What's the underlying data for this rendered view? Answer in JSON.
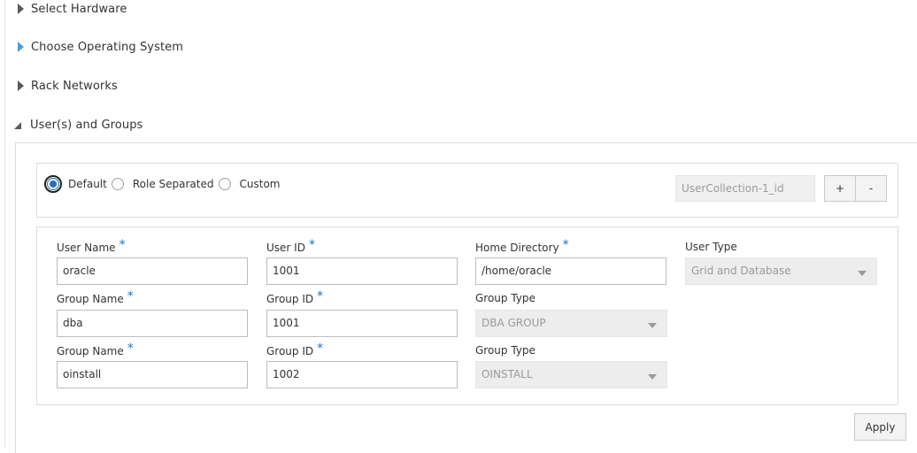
{
  "sections": [
    {
      "title": "Select Hardware",
      "state": "collapsed"
    },
    {
      "title": "Choose Operating System",
      "state": "collapsed"
    },
    {
      "title": "Rack Networks",
      "state": "collapsed"
    },
    {
      "title": "User(s) and Groups",
      "state": "expanded"
    }
  ],
  "user_groups": {
    "options": [
      "Default",
      "Role Separated",
      "Custom"
    ],
    "selected_option": "Default",
    "collection_id": "UserCollection-1_id",
    "add_label": "+",
    "remove_label": "-",
    "user_name_label": "User Name",
    "user_name_value": "oracle",
    "user_id_label": "User ID",
    "user_id_value": "1001",
    "home_dir_label": "Home Directory",
    "home_dir_value": "/home/oracle",
    "user_type_label": "User Type",
    "user_type_value": "Grid and Database",
    "groups": [
      {
        "name_label": "Group Name",
        "name_value": "dba",
        "id_label": "Group ID",
        "id_value": "1001",
        "type_label": "Group Type",
        "type_value": "DBA GROUP"
      },
      {
        "name_label": "Group Name",
        "name_value": "oinstall",
        "id_label": "Group ID",
        "id_value": "1002",
        "type_label": "Group Type",
        "type_value": "OINSTALL"
      }
    ],
    "required_marker": "*",
    "apply_label": "Apply"
  },
  "colors": {
    "accent": "#1f72b8",
    "expander_highlight": "#4a9fd8",
    "disabled_bg": "#ededed"
  }
}
